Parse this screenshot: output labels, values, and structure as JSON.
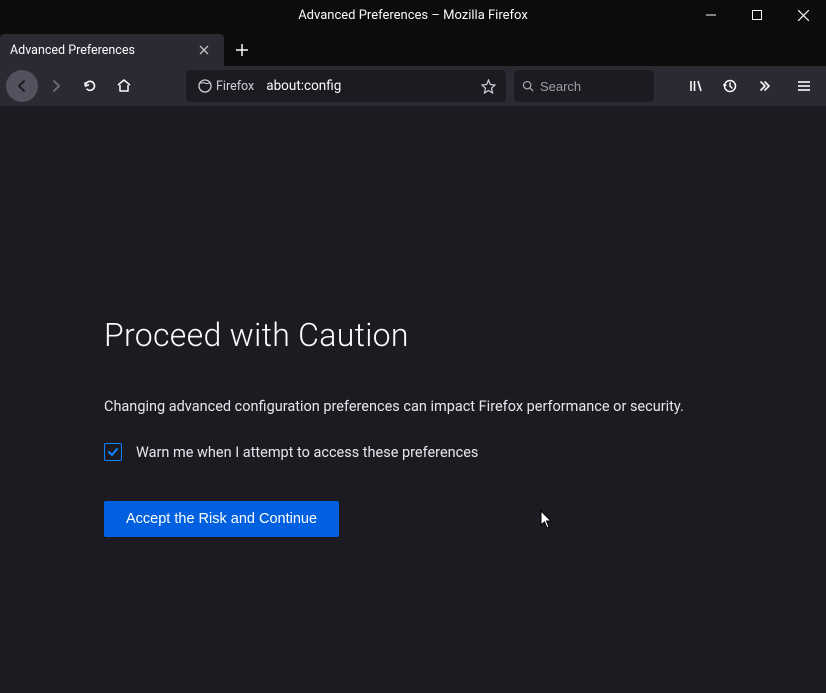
{
  "window": {
    "title": "Advanced Preferences – Mozilla Firefox"
  },
  "tab": {
    "label": "Advanced Preferences"
  },
  "urlbar": {
    "identity": "Firefox",
    "url": "about:config"
  },
  "searchbar": {
    "placeholder": "Search"
  },
  "content": {
    "heading": "Proceed with Caution",
    "warning_text": "Changing advanced configuration preferences can impact Firefox performance or security.",
    "checkbox_label": "Warn me when I attempt to access these preferences",
    "checkbox_checked": true,
    "accept_label": "Accept the Risk and Continue"
  }
}
